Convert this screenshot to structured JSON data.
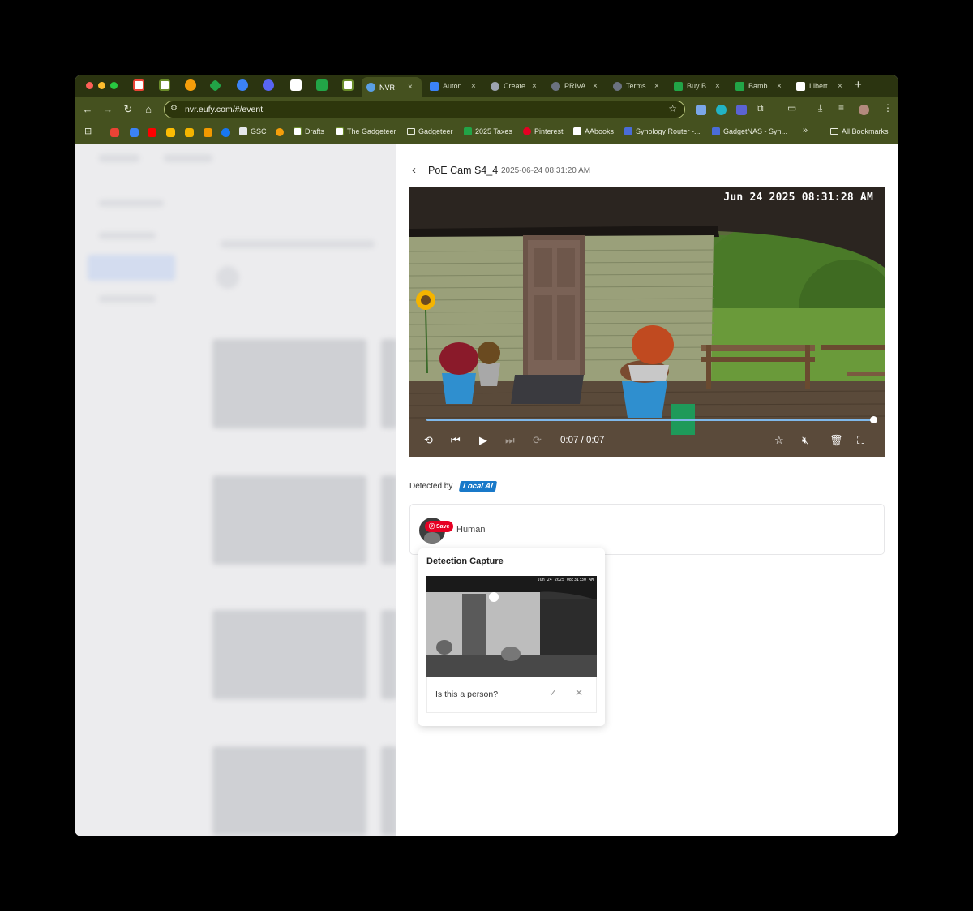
{
  "browser": {
    "tabs": [
      {
        "title": "Auton",
        "color": "#3b82f6"
      },
      {
        "title": "Create",
        "color": "#9ca3af"
      },
      {
        "title": "PRIVA",
        "color": "#6b7280"
      },
      {
        "title": "Terms",
        "color": "#6b7280"
      },
      {
        "title": "Buy B",
        "color": "#22a447"
      },
      {
        "title": "Bamb",
        "color": "#22a447"
      },
      {
        "title": "Libert",
        "color": "#ffffff"
      }
    ],
    "active_tab": {
      "title": "NVR"
    },
    "close_glyph": "×",
    "new_tab_glyph": "+",
    "url": "nvr.eufy.com/#/event",
    "bookmarks": [
      {
        "label": "GSC",
        "icon": "gsc-icon"
      },
      {
        "label": "Drafts",
        "icon": "gadgeteer-icon"
      },
      {
        "label": "The Gadgeteer",
        "icon": "gadgeteer-icon"
      },
      {
        "label": "Gadgeteer",
        "icon": "folder-icon"
      },
      {
        "label": "2025 Taxes",
        "icon": "sheets-icon"
      },
      {
        "label": "Pinterest",
        "icon": "pinterest-icon"
      },
      {
        "label": "AAbooks",
        "icon": "aabooks-icon"
      },
      {
        "label": "Synology Router -...",
        "icon": "synology-icon"
      },
      {
        "label": "GadgetNAS - Syn...",
        "icon": "synology-icon"
      }
    ],
    "bookmarks_overflow": "»",
    "all_bookmarks": "All Bookmarks"
  },
  "event": {
    "camera_name": "PoE Cam S4_4",
    "timestamp": "2025-06-24 08:31:20 AM",
    "video_overlay": "Jun 24 2025   08:31:28 AM",
    "playback_time": "0:07 / 0:07",
    "progress": 1.0,
    "detected_by_label": "Detected by",
    "ai_badge": "Local AI",
    "detection_type": "Human",
    "pinterest_save": "Save"
  },
  "popover": {
    "title": "Detection Capture",
    "capture_overlay": "Jun 24 2025  08:31:30 AM",
    "question": "Is this a person?"
  },
  "colors": {
    "chrome_bg": "#45511f",
    "accent_blue": "#1979c9",
    "progress": "#7fb8ea"
  }
}
